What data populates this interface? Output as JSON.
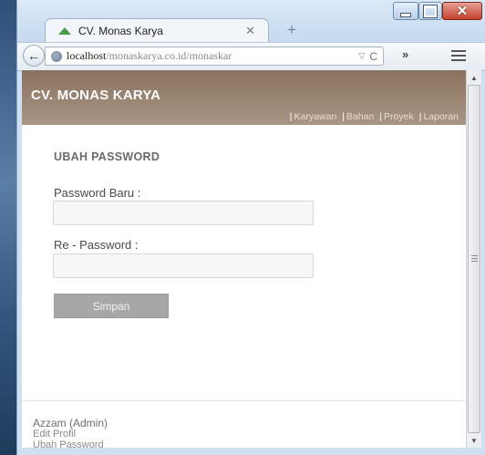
{
  "browser": {
    "tab_title": "CV. Monas Karya",
    "tab_close": "✕",
    "new_tab": "+",
    "url_host": "localhost",
    "url_path": "/monaskarya.co.id/monaskar",
    "reload_glyph": "C",
    "drop_glyph": "▽",
    "overflow_glyph": "»",
    "back_glyph": "←"
  },
  "app": {
    "brand": "CV. MONAS KARYA",
    "nav": [
      "Karyawan",
      "Bahan",
      "Proyek",
      "Laporan"
    ],
    "nav_separator": "|"
  },
  "form": {
    "title": "UBAH PASSWORD",
    "password_label": "Password Baru :",
    "password_value": "",
    "repassword_label": "Re - Password :",
    "repassword_value": "",
    "submit_label": "Simpan"
  },
  "footer": {
    "user": "Azzam (Admin)",
    "links": [
      "Edit Profil",
      "Ubah Password"
    ]
  },
  "colors": {
    "header_brown": "#9b8573",
    "button_gray": "#a7a7a7",
    "close_red": "#c4402c"
  },
  "icons": {
    "tab_favicon": "triangle-icon",
    "address_site": "globe-icon",
    "menu": "hamburger-menu-icon"
  }
}
